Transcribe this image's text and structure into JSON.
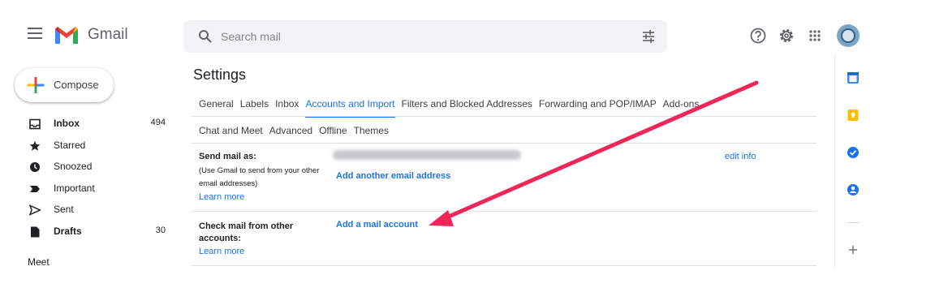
{
  "header": {
    "brand": "Gmail",
    "search": {
      "placeholder": "Search mail"
    },
    "icons": [
      "help-icon",
      "settings-gear-icon",
      "apps-grid-icon"
    ]
  },
  "compose": {
    "label": "Compose"
  },
  "nav": {
    "items": [
      {
        "label": "Inbox",
        "count": "494",
        "icon": "inbox-icon",
        "bold": true
      },
      {
        "label": "Starred",
        "count": "",
        "icon": "star-icon",
        "bold": false
      },
      {
        "label": "Snoozed",
        "count": "",
        "icon": "clock-icon",
        "bold": false
      },
      {
        "label": "Important",
        "count": "",
        "icon": "important-icon",
        "bold": false
      },
      {
        "label": "Sent",
        "count": "",
        "icon": "send-icon",
        "bold": false
      },
      {
        "label": "Drafts",
        "count": "30",
        "icon": "draft-icon",
        "bold": true
      }
    ],
    "meet_label": "Meet"
  },
  "settings": {
    "title": "Settings",
    "tabs_row1": [
      "General",
      "Labels",
      "Inbox",
      "Accounts and Import",
      "Filters and Blocked Addresses",
      "Forwarding and POP/IMAP",
      "Add-ons"
    ],
    "tabs_row2": [
      "Chat and Meet",
      "Advanced",
      "Offline",
      "Themes"
    ],
    "active_tab": "Accounts and Import",
    "send_mail": {
      "label": "Send mail as:",
      "desc_line1": "(Use Gmail to send from your other",
      "desc_line2": "email addresses)",
      "learn_more": "Learn more",
      "edit_info": "edit info",
      "add_address": "Add another email address"
    },
    "check_mail": {
      "label_line1": "Check mail from other",
      "label_line2": "accounts:",
      "learn_more": "Learn more",
      "add_account": "Add a mail account"
    }
  },
  "colors": {
    "accent": "#1a73e8",
    "arrow": "#f0265a"
  }
}
